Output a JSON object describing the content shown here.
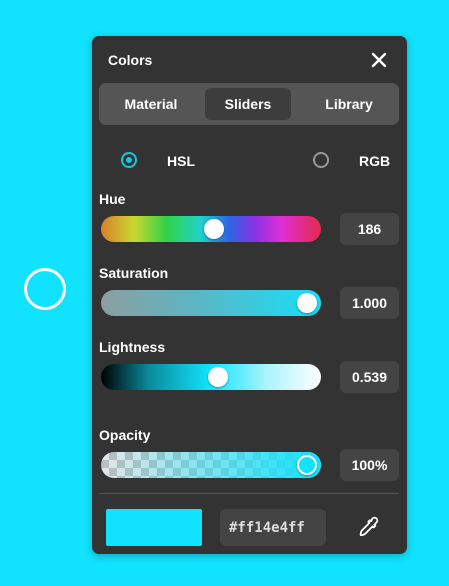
{
  "colors": {
    "accent": "#11e2fd",
    "panel": "#333333",
    "radio": "#13c8df"
  },
  "panel": {
    "title": "Colors",
    "close_icon": "close-icon"
  },
  "tabs": [
    {
      "label": "Material",
      "active": false
    },
    {
      "label": "Sliders",
      "active": true
    },
    {
      "label": "Library",
      "active": false
    }
  ],
  "mode": {
    "options": [
      {
        "label": "HSL",
        "selected": true
      },
      {
        "label": "RGB",
        "selected": false
      }
    ]
  },
  "sliders": {
    "hue": {
      "label": "Hue",
      "value": "186",
      "level": 0.5
    },
    "saturation": {
      "label": "Saturation",
      "value": "1.000",
      "level": 1.0
    },
    "lightness": {
      "label": "Lightness",
      "value": "0.539",
      "level": 0.539
    },
    "opacity": {
      "label": "Opacity",
      "value": "100%",
      "level": 1.0
    }
  },
  "footer": {
    "hex_value": "#ff14e4ff",
    "eyedropper_icon": "eyedropper-icon"
  }
}
